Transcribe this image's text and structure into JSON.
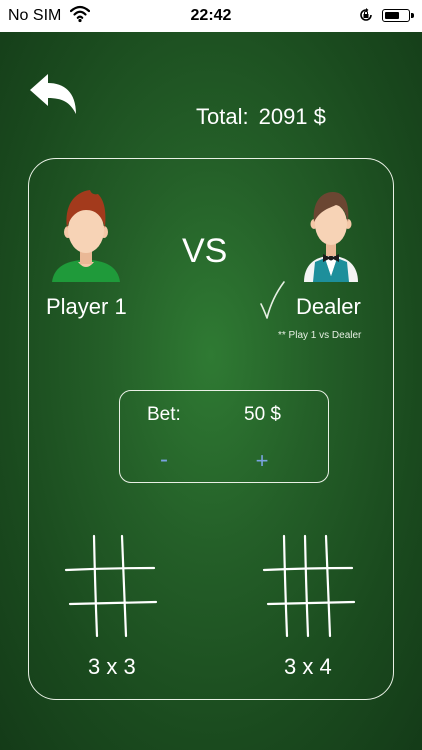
{
  "status_bar": {
    "carrier": "No SIM",
    "time": "22:42",
    "battery_level": 0.65
  },
  "header": {
    "total_label": "Total:",
    "total_amount": "2091 $"
  },
  "players": {
    "left_name": "Player 1",
    "vs_label": "VS",
    "right_name": "Dealer",
    "note": "** Play 1 vs Dealer"
  },
  "bet": {
    "label": "Bet:",
    "value": "50 $",
    "decrement_label": "-",
    "increment_label": "+"
  },
  "boards": {
    "option_3x3": "3 x 3",
    "option_3x4": "3 x 4"
  },
  "colors": {
    "felt": "#245f28",
    "accent_blue": "#7aa3e0",
    "player_shirt": "#1f9a3a",
    "dealer_vest": "#1e8f9b"
  }
}
